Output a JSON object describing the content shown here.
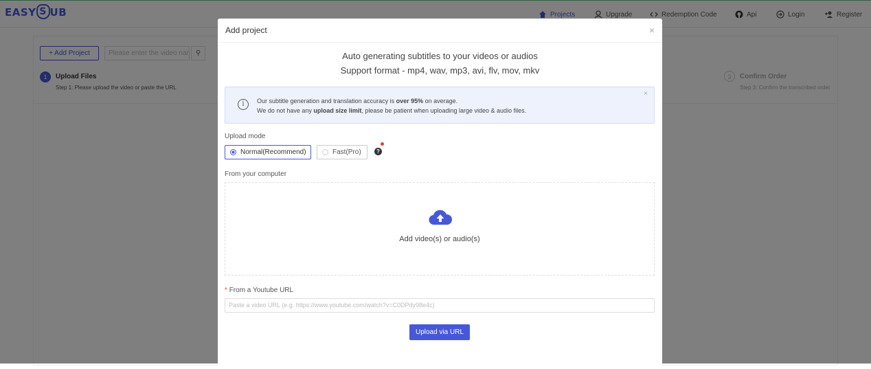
{
  "nav": {
    "logo": "EASY",
    "logo_s": "S",
    "logo_tail": "UB",
    "items": [
      {
        "label": "Projects"
      },
      {
        "label": "Upgrade"
      },
      {
        "label": "Redemption Code"
      },
      {
        "label": "Api"
      },
      {
        "label": "Login"
      },
      {
        "label": "Register"
      }
    ]
  },
  "background": {
    "add_project": "+ Add Project",
    "search_placeholder": "Please enter the video nam",
    "steps": [
      {
        "number": "1",
        "title": "Upload Files",
        "desc": "Step 1: Please upload the video or paste the URL"
      },
      {
        "number": "3",
        "title": "Confirm Order",
        "desc": "Step 3: Confirm the transcribed order"
      }
    ]
  },
  "modal": {
    "title": "Add project",
    "close": "×",
    "headline1": "Auto generating subtitles to your videos or audios",
    "headline2": "Support format - mp4, wav, mp3, avi, flv, mov, mkv",
    "info": {
      "line1_a": "Our subtitle generation and translation accuracy is ",
      "line1_b": "over 95%",
      "line1_c": " on average.",
      "line2_a": "We do not have any ",
      "line2_b": "upload size limit",
      "line2_c": ", please be patient when uploading large video & audio files.",
      "close": "×"
    },
    "upload_mode_label": "Upload mode",
    "modes": [
      {
        "label": "Normal(Recommend)",
        "selected": true
      },
      {
        "label": "Fast(Pro)",
        "selected": false
      }
    ],
    "help": "?",
    "computer_label": "From your computer",
    "drop_text": "Add video(s) or audio(s)",
    "youtube_required": "*",
    "youtube_label": "From a Youtube URL",
    "url_placeholder": "Paste a video URL (e.g. https://www.youtube.com/watch?v=C0DPdy98e4c)",
    "upload_button": "Upload via URL"
  },
  "colors": {
    "accent": "#4658d8",
    "required": "#e0433a"
  }
}
